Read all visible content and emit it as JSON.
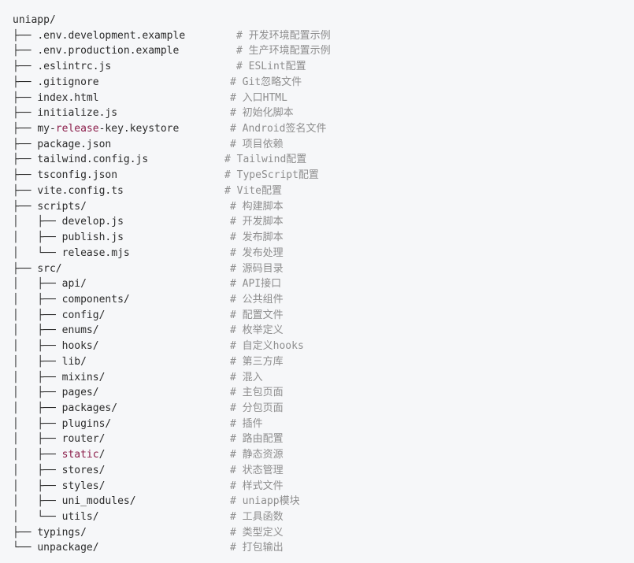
{
  "lines": [
    {
      "prefix": "",
      "name": "uniapp/",
      "comment": ""
    },
    {
      "prefix": "├── ",
      "name": ".env.development.example",
      "comment": "# 开发环境配置示例",
      "col": 300
    },
    {
      "prefix": "├── ",
      "name": ".env.production.example",
      "comment": "# 生产环境配置示例",
      "col": 300
    },
    {
      "prefix": "├── ",
      "name": ".eslintrc.js",
      "comment": "# ESLint配置",
      "col": 300
    },
    {
      "prefix": "├── ",
      "name": ".gitignore",
      "comment": "# Git忽略文件",
      "col": 292
    },
    {
      "prefix": "├── ",
      "name": "index.html",
      "comment": "# 入口HTML",
      "col": 292
    },
    {
      "prefix": "├── ",
      "name": "initialize.js",
      "comment": "# 初始化脚本",
      "col": 292
    },
    {
      "prefix": "├── ",
      "name_parts": [
        "my-",
        "release",
        "-key.keystore"
      ],
      "highlight": 1,
      "comment": "# Android签名文件",
      "col": 292
    },
    {
      "prefix": "├── ",
      "name": "package.json",
      "comment": "# 项目依赖",
      "col": 292
    },
    {
      "prefix": "├── ",
      "name": "tailwind.config.js",
      "comment": "# Tailwind配置",
      "col": 285
    },
    {
      "prefix": "├── ",
      "name": "tsconfig.json",
      "comment": "# TypeScript配置",
      "col": 285
    },
    {
      "prefix": "├── ",
      "name": "vite.config.ts",
      "comment": "# Vite配置",
      "col": 285
    },
    {
      "prefix": "├── ",
      "name": "scripts/",
      "comment": "# 构建脚本",
      "col": 292
    },
    {
      "prefix": "│   ├── ",
      "name": "develop.js",
      "comment": "# 开发脚本",
      "col": 292
    },
    {
      "prefix": "│   ├── ",
      "name": "publish.js",
      "comment": "# 发布脚本",
      "col": 292
    },
    {
      "prefix": "│   └── ",
      "name": "release.mjs",
      "comment": "# 发布处理",
      "col": 292
    },
    {
      "prefix": "├── ",
      "name": "src/",
      "comment": "# 源码目录",
      "col": 292
    },
    {
      "prefix": "│   ├── ",
      "name": "api/",
      "comment": "# API接口",
      "col": 292
    },
    {
      "prefix": "│   ├── ",
      "name": "components/",
      "comment": "# 公共组件",
      "col": 292
    },
    {
      "prefix": "│   ├── ",
      "name": "config/",
      "comment": "# 配置文件",
      "col": 292
    },
    {
      "prefix": "│   ├── ",
      "name": "enums/",
      "comment": "# 枚举定义",
      "col": 292
    },
    {
      "prefix": "│   ├── ",
      "name": "hooks/",
      "comment": "# 自定义hooks",
      "col": 292
    },
    {
      "prefix": "│   ├── ",
      "name": "lib/",
      "comment": "# 第三方库",
      "col": 292
    },
    {
      "prefix": "│   ├── ",
      "name": "mixins/",
      "comment": "# 混入",
      "col": 292
    },
    {
      "prefix": "│   ├── ",
      "name": "pages/",
      "comment": "# 主包页面",
      "col": 292
    },
    {
      "prefix": "│   ├── ",
      "name": "packages/",
      "comment": "# 分包页面",
      "col": 292
    },
    {
      "prefix": "│   ├── ",
      "name": "plugins/",
      "comment": "# 插件",
      "col": 292
    },
    {
      "prefix": "│   ├── ",
      "name": "router/",
      "comment": "# 路由配置",
      "col": 292
    },
    {
      "prefix": "│   ├── ",
      "name_parts": [
        "static",
        "/"
      ],
      "highlight": 0,
      "comment": "# 静态资源",
      "col": 292
    },
    {
      "prefix": "│   ├── ",
      "name": "stores/",
      "comment": "# 状态管理",
      "col": 292
    },
    {
      "prefix": "│   ├── ",
      "name": "styles/",
      "comment": "# 样式文件",
      "col": 292
    },
    {
      "prefix": "│   ├── ",
      "name": "uni_modules/",
      "comment": "# uniapp模块",
      "col": 292
    },
    {
      "prefix": "│   └── ",
      "name": "utils/",
      "comment": "# 工具函数",
      "col": 292
    },
    {
      "prefix": "├── ",
      "name": "typings/",
      "comment": "# 类型定义",
      "col": 292
    },
    {
      "prefix": "└── ",
      "name": "unpackage/",
      "comment": "# 打包输出",
      "col": 292
    }
  ]
}
